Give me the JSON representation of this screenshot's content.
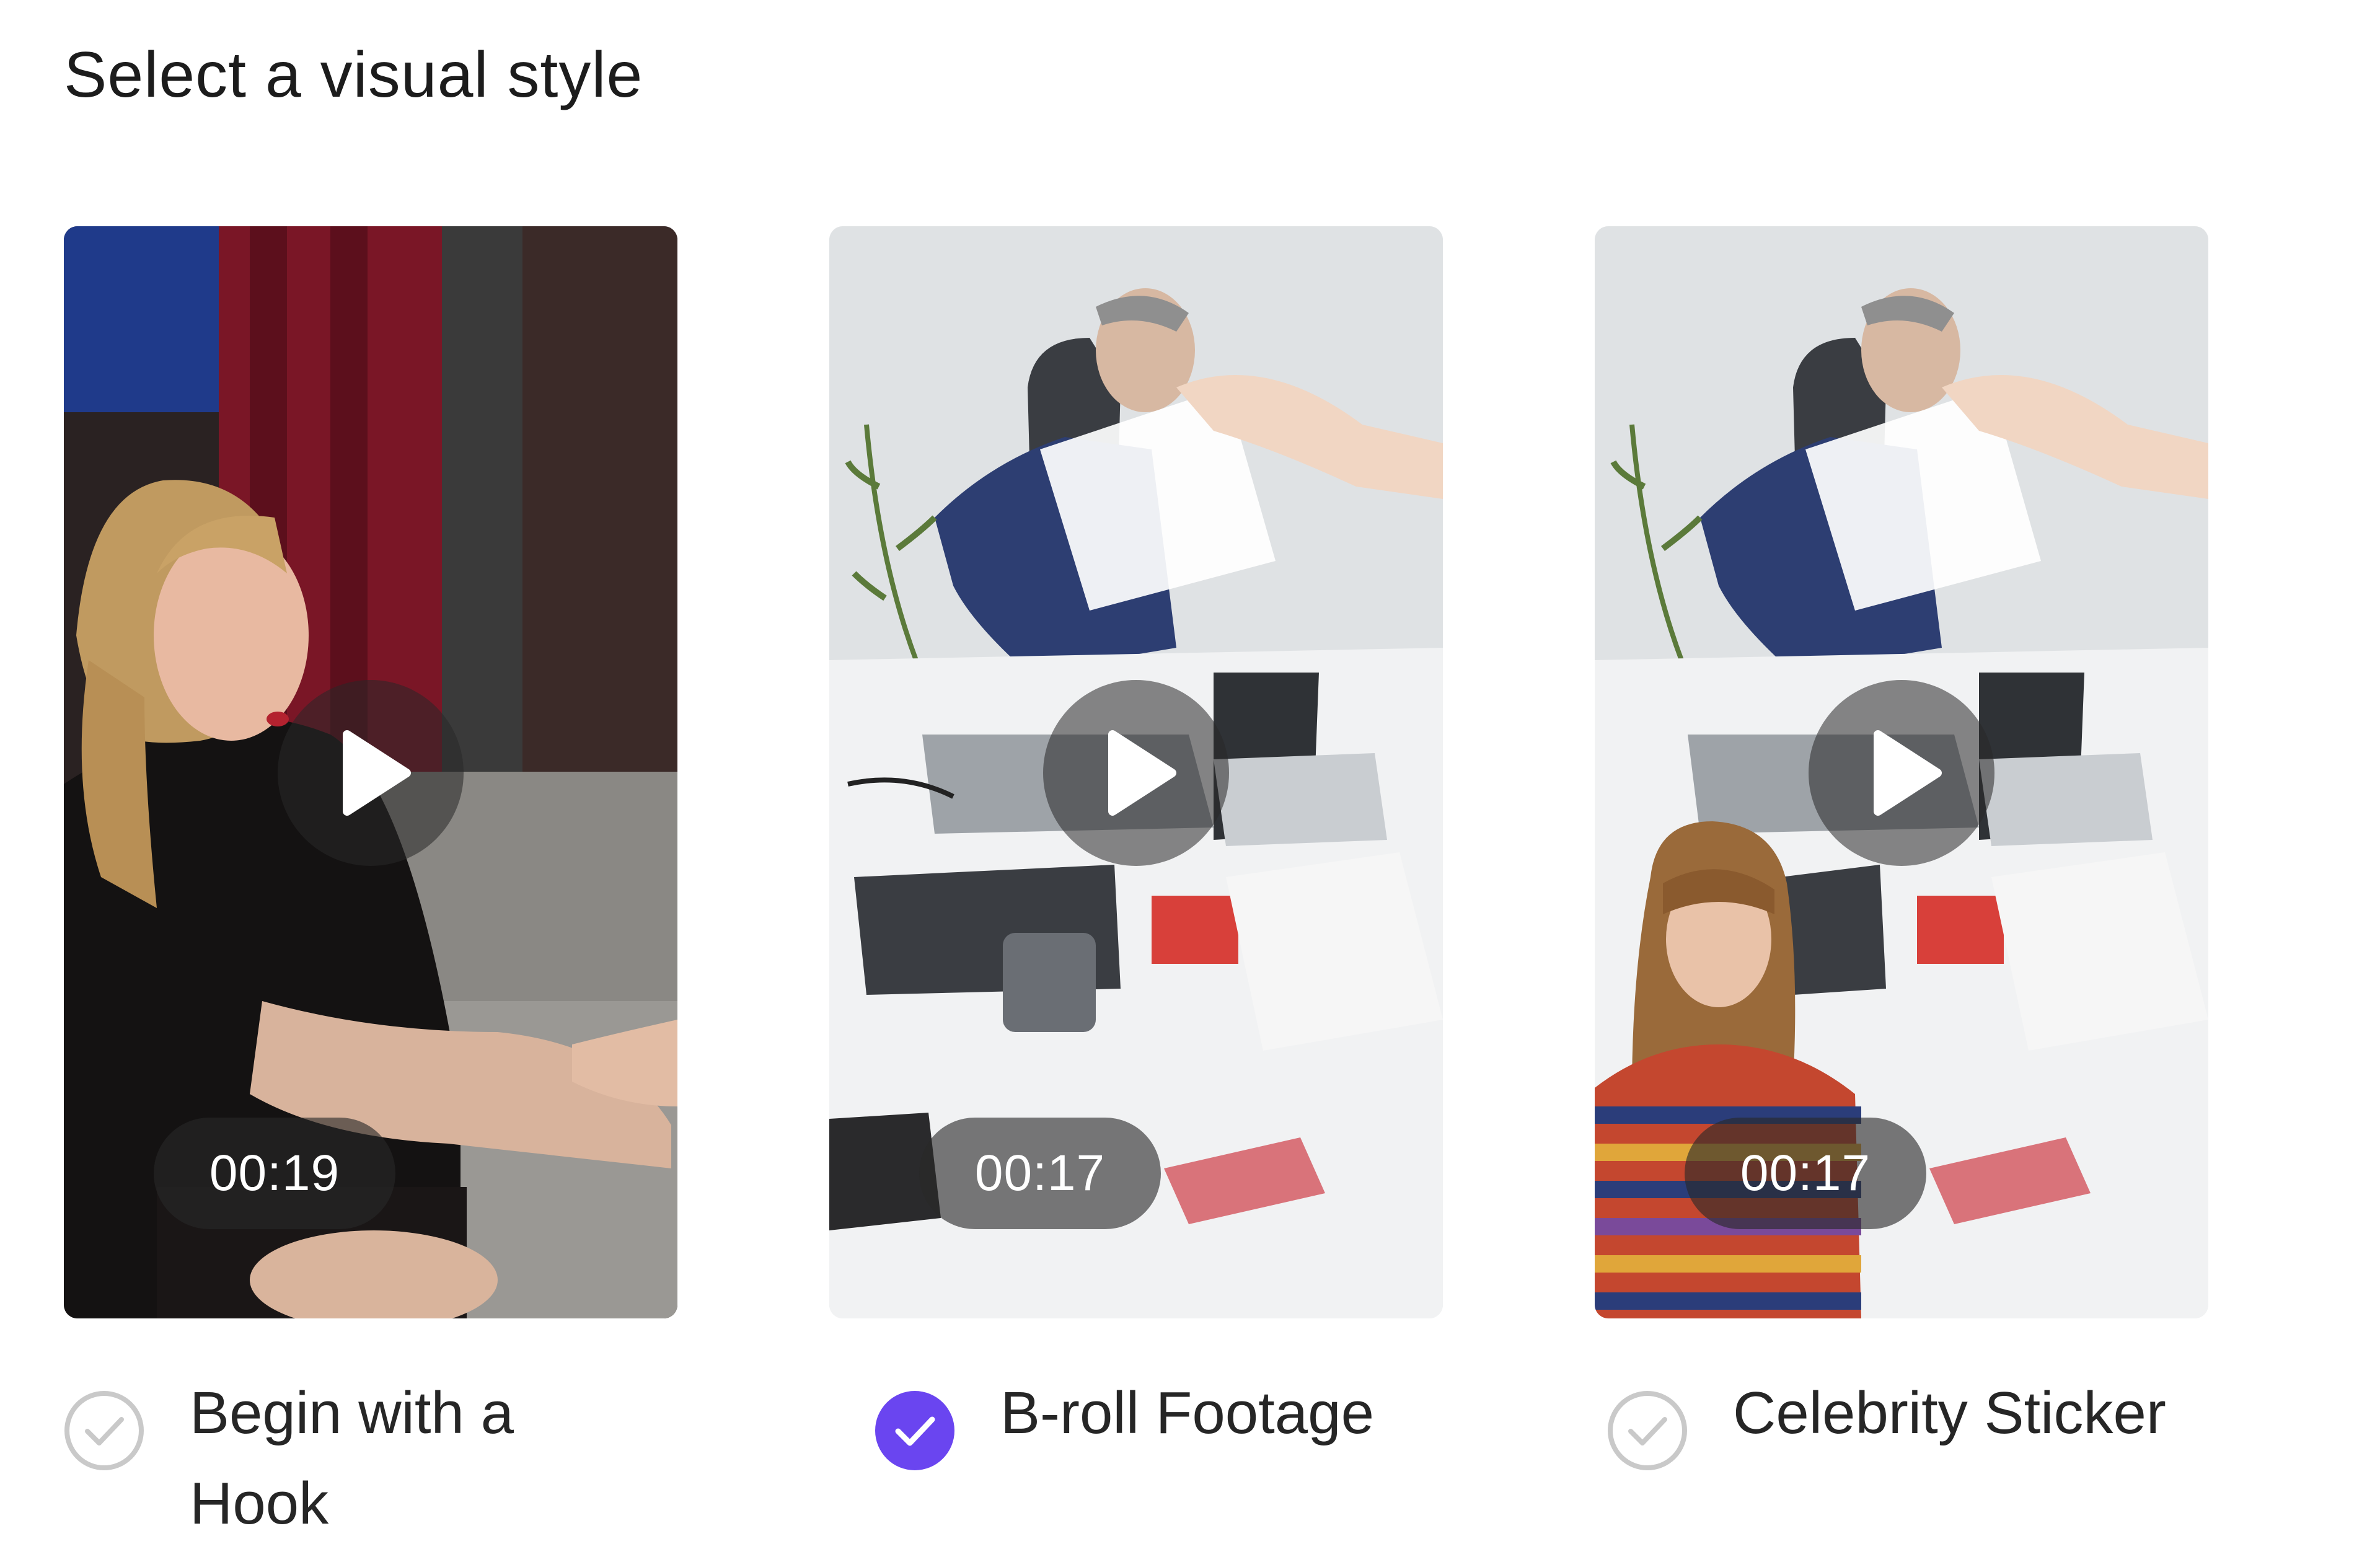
{
  "page": {
    "title": "Select a visual style"
  },
  "styles": [
    {
      "label": "Begin with a Hook",
      "duration": "00:19",
      "selected": false,
      "thumbnail": "talk-show-guest-scene"
    },
    {
      "label": "B-roll Footage",
      "duration": "00:17",
      "selected": true,
      "thumbnail": "office-paper-toss-scene"
    },
    {
      "label": "Celebrity Sticker",
      "duration": "00:17",
      "selected": false,
      "thumbnail": "office-scene-with-celebrity-sticker"
    }
  ],
  "colors": {
    "accent": "#6a45f0",
    "check_inactive": "#c9c9c9",
    "overlay": "#282828"
  },
  "icons": {
    "play": "play-icon",
    "check": "check-icon"
  }
}
